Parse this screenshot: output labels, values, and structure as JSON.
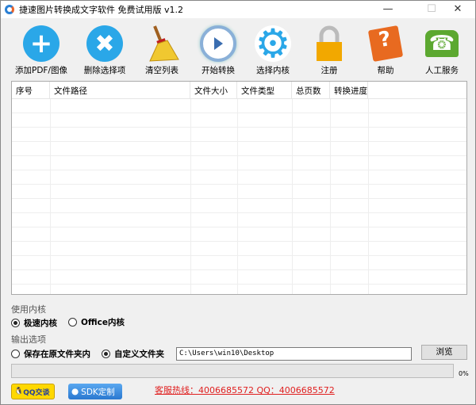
{
  "window": {
    "title": "捷速图片转换成文字软件 免费试用版 v1.2",
    "minimize": "—",
    "maximize": "☐",
    "close": "✕"
  },
  "toolbar": [
    {
      "label": "添加PDF/图像",
      "icon": "plus-icon",
      "color": "#2aa7e8"
    },
    {
      "label": "删除选择项",
      "icon": "x-icon",
      "color": "#2aa7e8"
    },
    {
      "label": "清空列表",
      "icon": "broom-icon",
      "color": "#e8c020"
    },
    {
      "label": "开始转换",
      "icon": "play-icon",
      "color": "#3a6db0"
    },
    {
      "label": "选择内核",
      "icon": "gear-icon",
      "color": "#2aa7e8"
    },
    {
      "label": "注册",
      "icon": "lock-icon",
      "color": "#f0a800"
    },
    {
      "label": "帮助",
      "icon": "help-book-icon",
      "color": "#e86a20"
    },
    {
      "label": "人工服务",
      "icon": "phone-icon",
      "color": "#5ca830"
    }
  ],
  "table": {
    "columns": [
      "序号",
      "文件路径",
      "文件大小",
      "文件类型",
      "总页数",
      "转换进度"
    ],
    "rows": []
  },
  "engine": {
    "title": "使用内核",
    "options": [
      {
        "label": "极速内核",
        "selected": true
      },
      {
        "label": "Office内核",
        "selected": false
      }
    ]
  },
  "output": {
    "title": "输出选项",
    "options": [
      {
        "label": "保存在原文件夹内",
        "selected": false
      },
      {
        "label": "自定义文件夹",
        "selected": true
      }
    ],
    "path": "C:\\Users\\win10\\Desktop",
    "browse": "浏览"
  },
  "progress": {
    "value": 0,
    "label": "0%"
  },
  "footer": {
    "qq": "QQ交谈",
    "sdk": "SDK定制",
    "hotline": "客服热线：4006685572 QQ：4006685572"
  }
}
